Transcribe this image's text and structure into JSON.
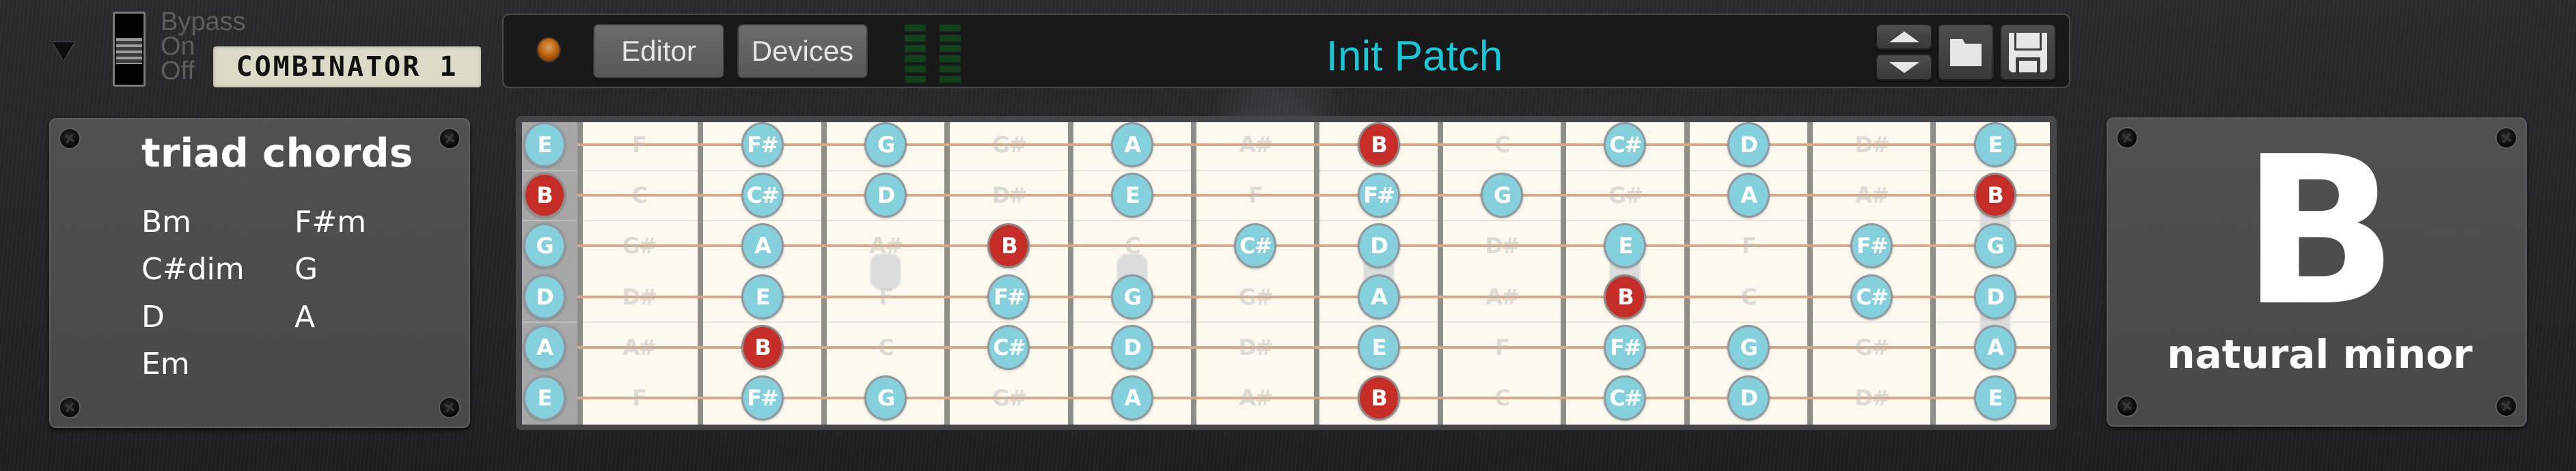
{
  "device": {
    "bypass_labels": [
      "Bypass",
      "On",
      "Off"
    ],
    "name": "COMBINATOR 1",
    "buttons": {
      "editor": "Editor",
      "devices": "Devices"
    },
    "patch_name": "Init Patch",
    "icons": {
      "fold": "fold-triangle-icon",
      "led": "activity-led-icon",
      "meter": "level-meter-icon",
      "patch_up": "triangle-up-icon",
      "patch_down": "triangle-down-icon",
      "browse": "folder-icon",
      "save": "floppy-disk-icon"
    },
    "colors": {
      "patch_name": "#19c8d8",
      "led": "#c0650e",
      "meter_off": "#12401d"
    }
  },
  "chords_panel": {
    "title": "triad chords",
    "chords": [
      "Bm",
      "C#dim",
      "D",
      "Em",
      "F#m",
      "G",
      "A"
    ]
  },
  "key_panel": {
    "root": "B",
    "scale": "natural minor"
  },
  "fretboard": {
    "tuning": [
      "E",
      "B",
      "G",
      "D",
      "A",
      "E"
    ],
    "fret_count": 12,
    "root": "B",
    "scale_notes": [
      "B",
      "C#",
      "D",
      "E",
      "F#",
      "G",
      "A"
    ],
    "single_dot_frets": [
      3,
      5,
      7,
      9
    ],
    "double_dot_frets": [
      12
    ],
    "colors": {
      "scale_note": "#84d0dc",
      "root_note": "#c62d27",
      "board": "#fdf9ee"
    },
    "strings": [
      [
        "E",
        "F",
        "F#",
        "G",
        "G#",
        "A",
        "A#",
        "B",
        "C",
        "C#",
        "D",
        "D#",
        "E"
      ],
      [
        "B",
        "C",
        "C#",
        "D",
        "D#",
        "E",
        "F",
        "F#",
        "G",
        "G#",
        "A",
        "A#",
        "B"
      ],
      [
        "G",
        "G#",
        "A",
        "A#",
        "B",
        "C",
        "C#",
        "D",
        "D#",
        "E",
        "F",
        "F#",
        "G"
      ],
      [
        "D",
        "D#",
        "E",
        "F",
        "F#",
        "G",
        "G#",
        "A",
        "A#",
        "B",
        "C",
        "C#",
        "D"
      ],
      [
        "A",
        "A#",
        "B",
        "C",
        "C#",
        "D",
        "D#",
        "E",
        "F",
        "F#",
        "G",
        "G#",
        "A"
      ],
      [
        "E",
        "F",
        "F#",
        "G",
        "G#",
        "A",
        "A#",
        "B",
        "C",
        "C#",
        "D",
        "D#",
        "E"
      ]
    ]
  }
}
